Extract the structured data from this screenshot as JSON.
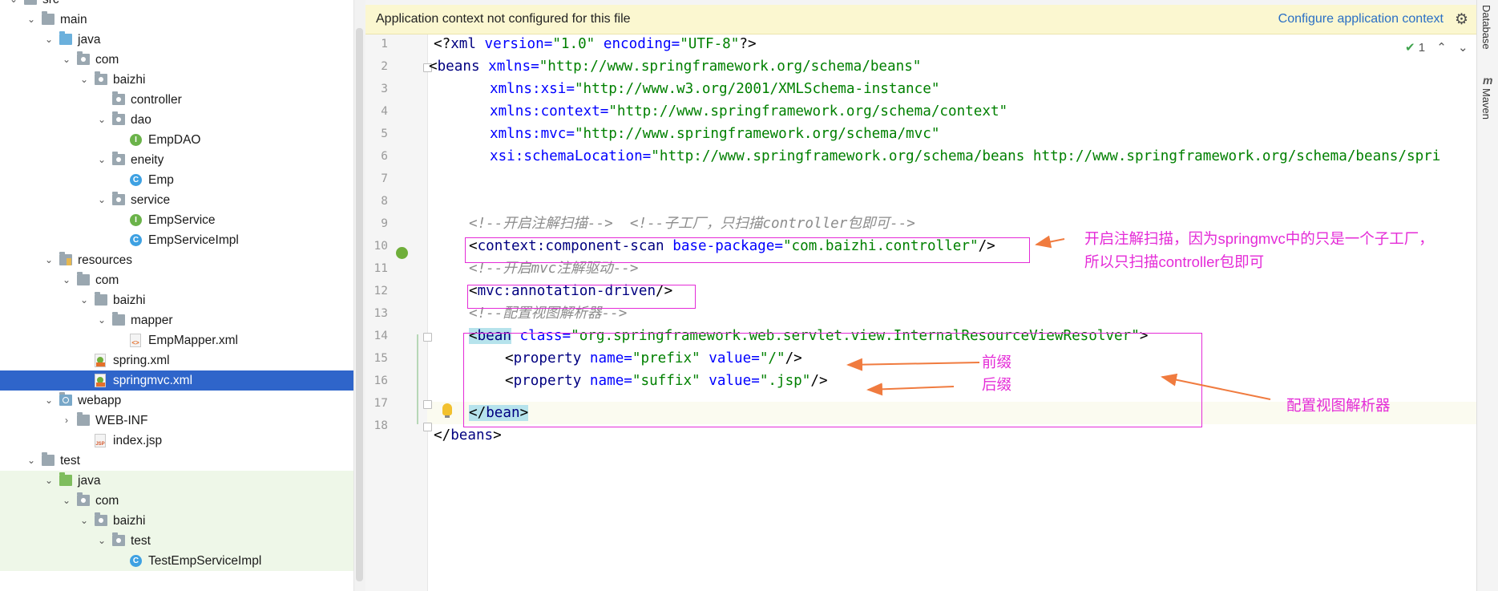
{
  "project_tree": {
    "items": [
      {
        "label": "src",
        "icon": "folder-icon",
        "chev": "⌄"
      },
      {
        "label": "main",
        "icon": "folder-icon",
        "chev": "⌄"
      },
      {
        "label": "java",
        "icon": "source-folder-icon",
        "chev": "⌄"
      },
      {
        "label": "com",
        "icon": "package-icon",
        "chev": "⌄"
      },
      {
        "label": "baizhi",
        "icon": "package-icon",
        "chev": "⌄"
      },
      {
        "label": "controller",
        "icon": "package-icon",
        "chev": ""
      },
      {
        "label": "dao",
        "icon": "package-icon",
        "chev": "⌄"
      },
      {
        "label": "EmpDAO",
        "icon": "interface-icon",
        "chev": ""
      },
      {
        "label": "eneity",
        "icon": "package-icon",
        "chev": "⌄"
      },
      {
        "label": "Emp",
        "icon": "class-icon",
        "chev": ""
      },
      {
        "label": "service",
        "icon": "package-icon",
        "chev": "⌄"
      },
      {
        "label": "EmpService",
        "icon": "interface-icon",
        "chev": ""
      },
      {
        "label": "EmpServiceImpl",
        "icon": "class-icon",
        "chev": ""
      },
      {
        "label": "resources",
        "icon": "resources-folder-icon",
        "chev": "⌄"
      },
      {
        "label": "com",
        "icon": "folder-icon",
        "chev": "⌄"
      },
      {
        "label": "baizhi",
        "icon": "folder-icon",
        "chev": "⌄"
      },
      {
        "label": "mapper",
        "icon": "folder-icon",
        "chev": "⌄"
      },
      {
        "label": "EmpMapper.xml",
        "icon": "xml-file-icon",
        "chev": ""
      },
      {
        "label": "spring.xml",
        "icon": "spring-xml-icon",
        "chev": ""
      },
      {
        "label": "springmvc.xml",
        "icon": "spring-xml-icon",
        "chev": "",
        "selected": true
      },
      {
        "label": "webapp",
        "icon": "web-folder-icon",
        "chev": "⌄"
      },
      {
        "label": "WEB-INF",
        "icon": "folder-icon",
        "chev": "›"
      },
      {
        "label": "index.jsp",
        "icon": "jsp-file-icon",
        "chev": ""
      },
      {
        "label": "test",
        "icon": "folder-icon",
        "chev": "⌄"
      },
      {
        "label": "java",
        "icon": "test-folder-icon",
        "chev": "⌄"
      },
      {
        "label": "com",
        "icon": "package-icon",
        "chev": "⌄"
      },
      {
        "label": "baizhi",
        "icon": "package-icon",
        "chev": "⌄"
      },
      {
        "label": "test",
        "icon": "package-icon",
        "chev": "⌄"
      },
      {
        "label": "TestEmpServiceImpl",
        "icon": "test-class-icon",
        "chev": ""
      }
    ]
  },
  "banner": {
    "message": "Application context not configured for this file",
    "action": "Configure application context"
  },
  "inspection": {
    "count": "1"
  },
  "editor": {
    "line_numbers": [
      "1",
      "2",
      "3",
      "4",
      "5",
      "6",
      "7",
      "8",
      "9",
      "10",
      "11",
      "12",
      "13",
      "14",
      "15",
      "16",
      "17",
      "18"
    ],
    "lines": {
      "l1": [
        "<?",
        "xml",
        " version=",
        "\"1.0\"",
        " encoding=",
        "\"UTF-8\"",
        "?>"
      ],
      "l2": [
        "<",
        "beans",
        " xmlns=",
        "\"http://www.springframework.org/schema/beans\""
      ],
      "l3": [
        "xmlns:",
        "xsi",
        "=",
        "\"http://www.w3.org/2001/XMLSchema-instance\""
      ],
      "l4": [
        "xmlns:",
        "context",
        "=",
        "\"http://www.springframework.org/schema/context\""
      ],
      "l5": [
        "xmlns:",
        "mvc",
        "=",
        "\"http://www.springframework.org/schema/mvc\""
      ],
      "l6": [
        "xsi:",
        "schemaLocation",
        "=",
        "\"http://www.springframework.org/schema/beans http://www.springframework.org/schema/beans/spri"
      ],
      "l9": "<!--开启注解扫描-->  <!--子工厂，只扫描controller包即可-->",
      "l10": [
        "<",
        "context:component-scan",
        " base-package=",
        "\"com.baizhi.controller\"",
        "/>"
      ],
      "l11": "<!--开启mvc注解驱动-->",
      "l12": [
        "<",
        "mvc:annotation-driven",
        "/>"
      ],
      "l13": "<!--配置视图解析器-->",
      "l14": [
        "<",
        "bean",
        " class=",
        "\"org.springframework.web.servlet.view.InternalResourceViewResolver\"",
        ">"
      ],
      "l15": [
        "<",
        "property",
        " name=",
        "\"prefix\"",
        " value=",
        "\"/\"",
        "/>"
      ],
      "l16": [
        "<",
        "property",
        " name=",
        "\"suffix\"",
        " value=",
        "\".jsp\"",
        "/>"
      ],
      "l17": [
        "</",
        "bean",
        ">"
      ],
      "l18": [
        "</",
        "beans",
        ">"
      ]
    }
  },
  "annotations": {
    "scan": "开启注解扫描，因为springmvc中的只是一个子工厂，\n所以只扫描controller包即可",
    "prefix": "前缀",
    "suffix": "后缀",
    "resolver": "配置视图解析器"
  },
  "side_tabs": {
    "database": "Database",
    "maven": "Maven"
  },
  "colors": {
    "annotation": "#e42bd7",
    "arrow": "#f07b3f",
    "selection": "#2f65ca",
    "banner_bg": "#fbf7d0"
  }
}
